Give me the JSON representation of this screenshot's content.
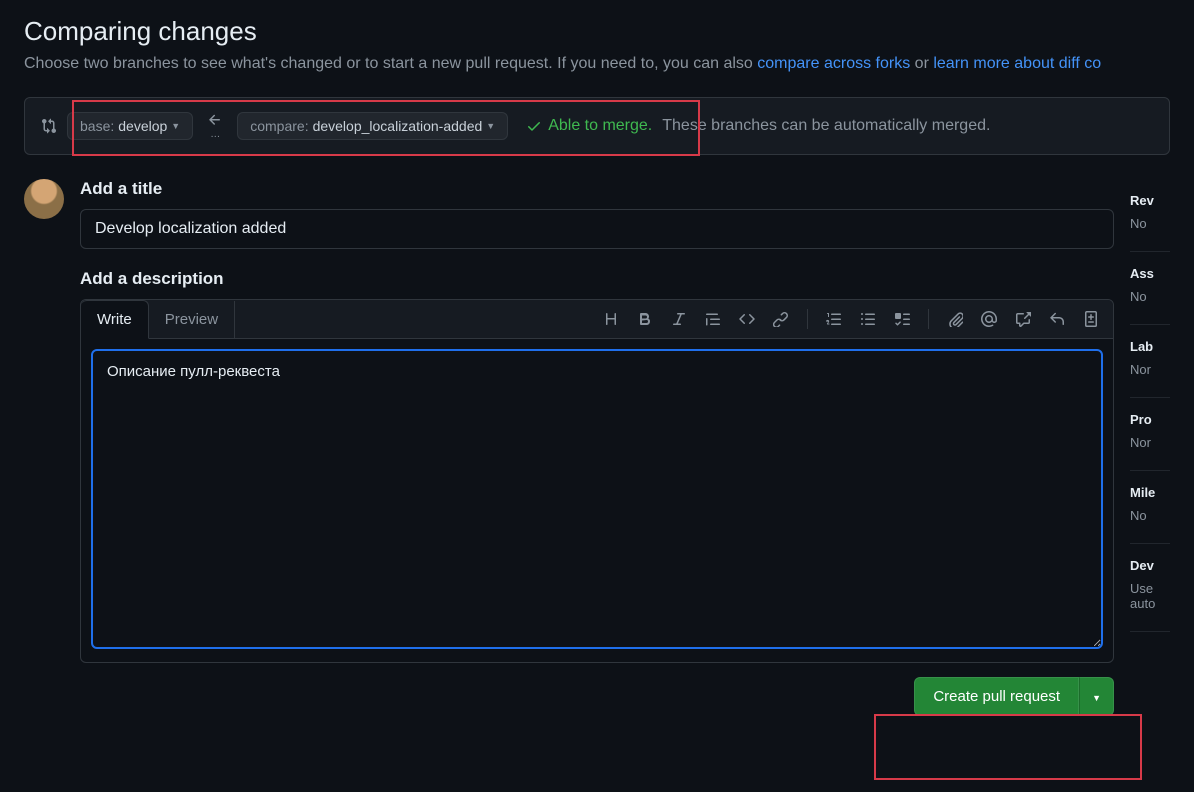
{
  "header": {
    "title": "Comparing changes",
    "subtitle_pre": "Choose two branches to see what's changed or to start a new pull request. If you need to, you can also ",
    "link1": "compare across forks",
    "subtitle_mid": " or ",
    "link2": "learn more about diff co"
  },
  "branches": {
    "base_label": "base:",
    "base_value": "develop",
    "compare_label": "compare:",
    "compare_value": "develop_localization-added",
    "merge_status": "Able to merge.",
    "merge_note": "These branches can be automatically merged."
  },
  "form": {
    "title_label": "Add a title",
    "title_value": "Develop localization added",
    "desc_label": "Add a description",
    "desc_value": "Описание пулл-реквеста",
    "tab_write": "Write",
    "tab_preview": "Preview",
    "create_btn": "Create pull request"
  },
  "sidebar": {
    "rev": {
      "label": "Rev",
      "value": "No "
    },
    "ass": {
      "label": "Ass",
      "value": "No "
    },
    "lab": {
      "label": "Lab",
      "value": "Nor"
    },
    "pro": {
      "label": "Pro",
      "value": "Nor"
    },
    "mile": {
      "label": "Mile",
      "value": "No "
    },
    "dev": {
      "label": "Dev",
      "line1": "Use",
      "line2": "auto"
    }
  }
}
